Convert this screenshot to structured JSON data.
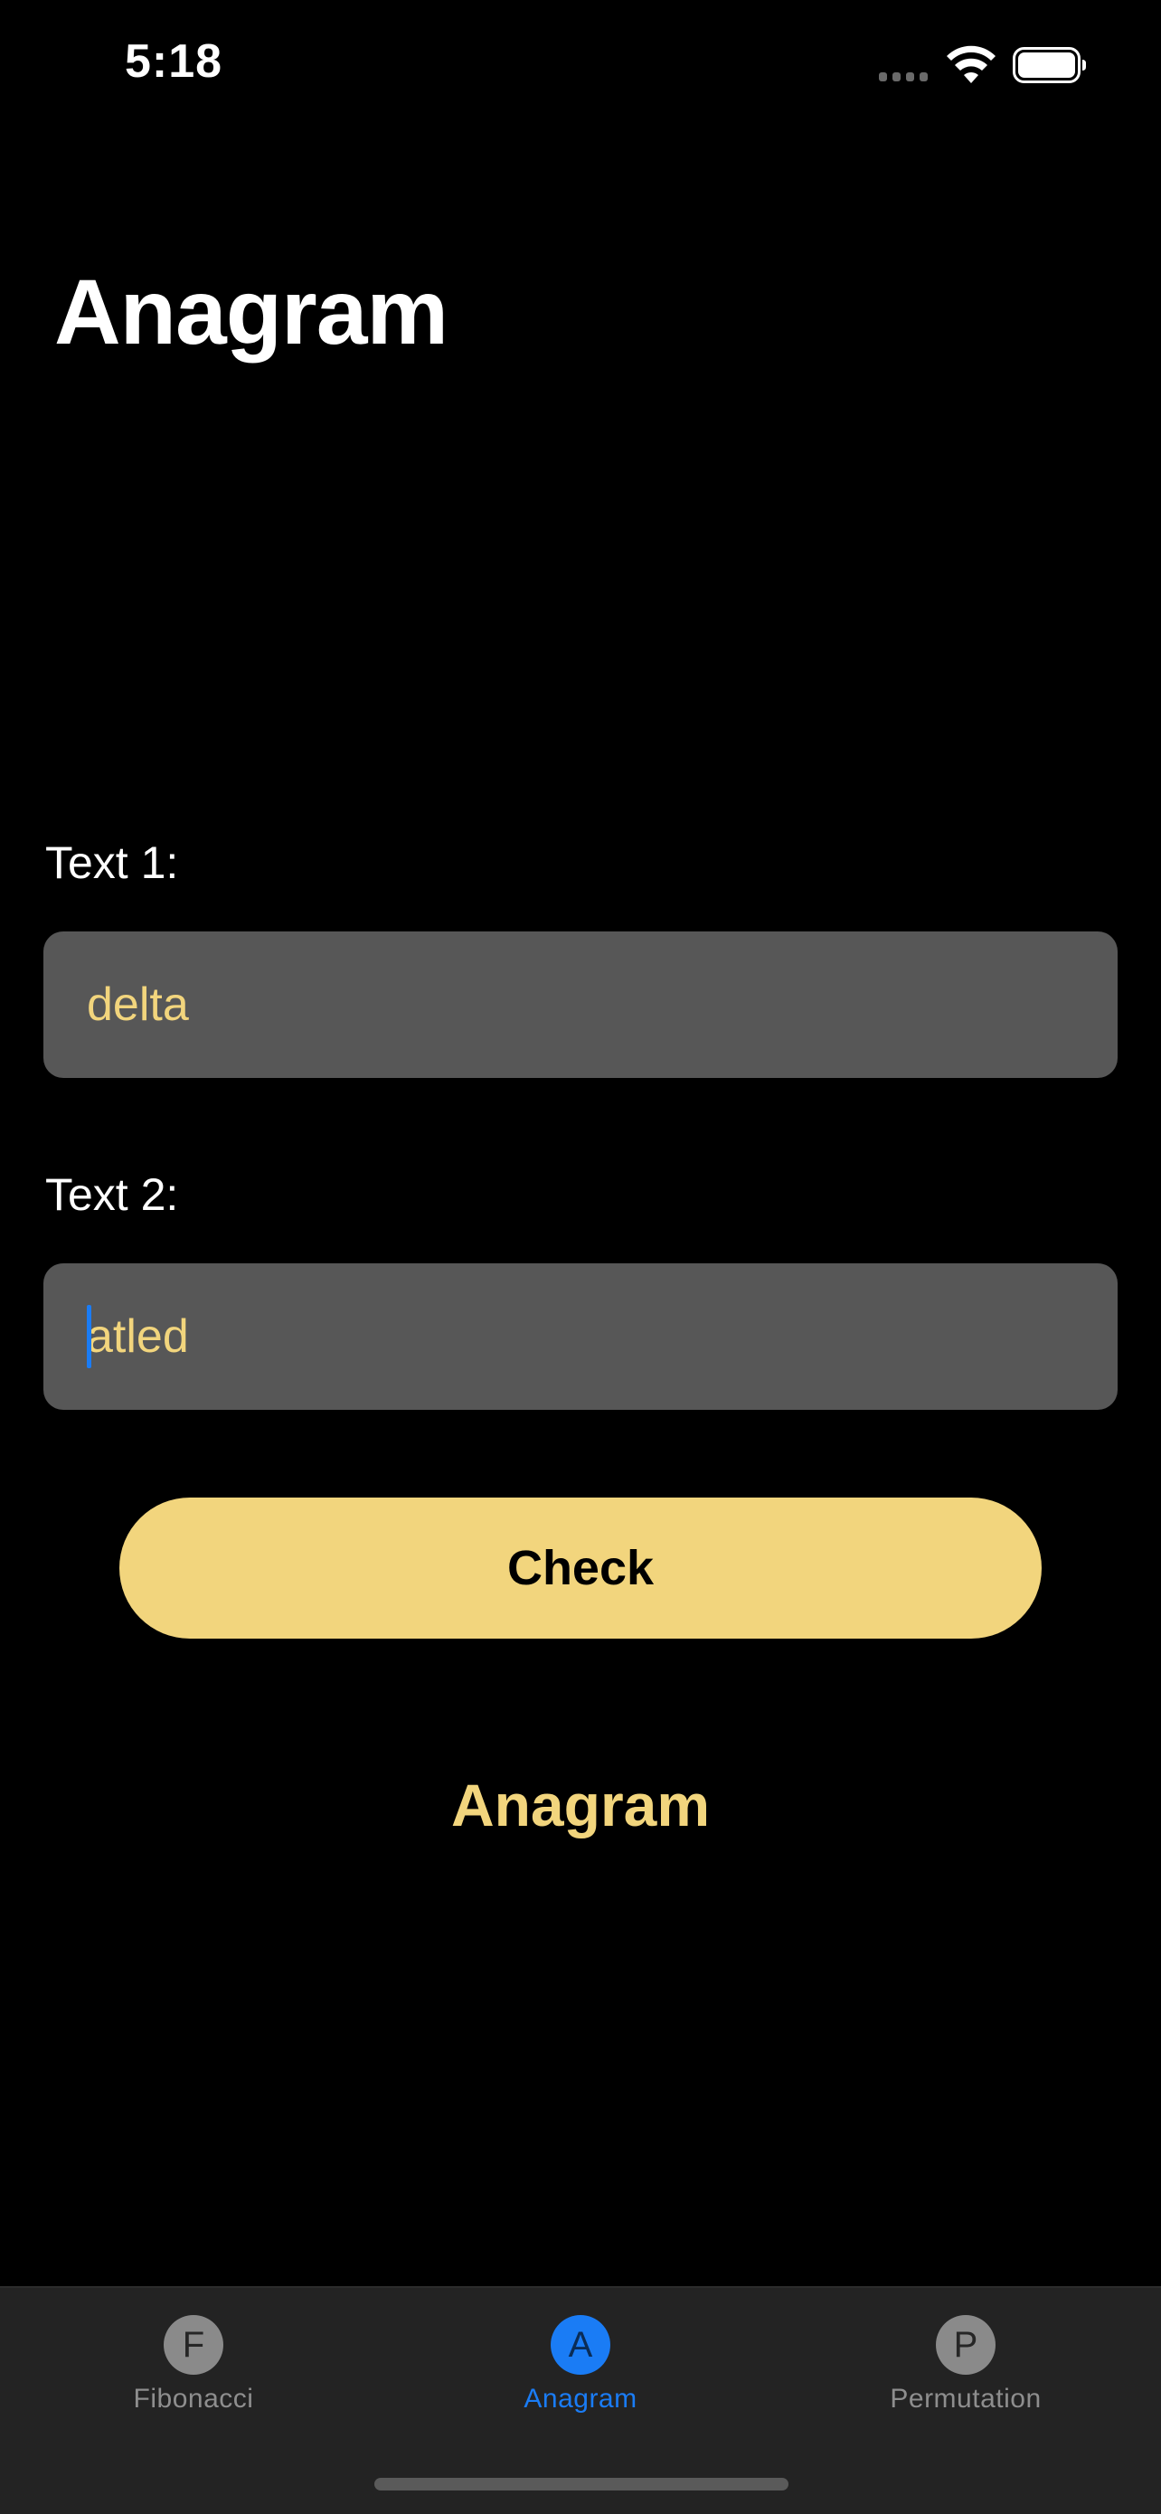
{
  "status_bar": {
    "time": "5:18"
  },
  "title": "Anagram",
  "form": {
    "text1_label": "Text 1:",
    "text1_value": "delta",
    "text2_label": "Text 2:",
    "text2_value": "atled",
    "check_label": "Check"
  },
  "result": "Anagram",
  "tabs": [
    {
      "icon_letter": "F",
      "label": "Fibonacci",
      "active": false
    },
    {
      "icon_letter": "A",
      "label": "Anagram",
      "active": true
    },
    {
      "icon_letter": "P",
      "label": "Permutation",
      "active": false
    }
  ],
  "colors": {
    "accent": "#f2d57d",
    "active_tab": "#1a7cf5",
    "field_bg": "#575757",
    "background": "#000000"
  },
  "icons": {
    "signal": "cellular-signal-icon",
    "wifi": "wifi-icon",
    "battery": "battery-icon"
  }
}
